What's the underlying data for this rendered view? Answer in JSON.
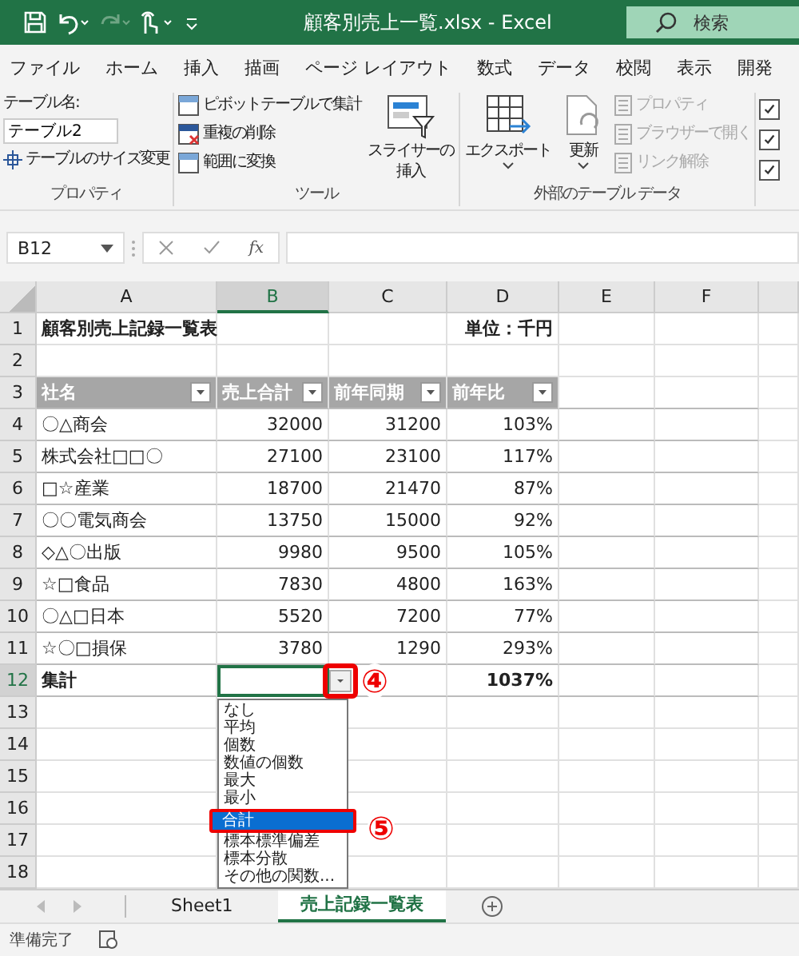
{
  "title_bar": {
    "title": "顧客別売上一覧.xlsx  -  Excel",
    "search": {
      "placeholder": "検索"
    }
  },
  "menu_tabs": [
    "ファイル",
    "ホーム",
    "挿入",
    "描画",
    "ページ レイアウト",
    "数式",
    "データ",
    "校閲",
    "表示",
    "開発"
  ],
  "ribbon": {
    "properties": {
      "label": "プロパティ",
      "name_label": "テーブル名:",
      "name_value": "テーブル2",
      "resize": "テーブルのサイズ変更"
    },
    "tools": {
      "label": "ツール",
      "buttons": [
        "ピボットテーブルで集計",
        "重複の削除",
        "範囲に変換"
      ],
      "slicer": [
        "スライサーの",
        "挿入"
      ]
    },
    "external": {
      "label": "外部のテーブル データ",
      "large": [
        "エクスポート",
        "更新"
      ],
      "small": [
        {
          "label": "プロパティ",
          "disabled": true
        },
        {
          "label": "ブラウザーで開く",
          "disabled": true
        },
        {
          "label": "リンク解除",
          "disabled": true
        }
      ]
    },
    "style_options": [
      {
        "checked": true
      },
      {
        "checked": true
      },
      {
        "checked": true
      }
    ]
  },
  "formula_bar": {
    "name_box": "B12",
    "fx": "fx"
  },
  "sheet": {
    "columns": [
      {
        "label": "A",
        "selected": false
      },
      {
        "label": "B",
        "selected": true
      },
      {
        "label": "C",
        "selected": false
      },
      {
        "label": "D",
        "selected": false
      },
      {
        "label": "E",
        "selected": false
      },
      {
        "label": "F",
        "selected": false
      }
    ],
    "rows": [
      {
        "number": "1",
        "kind": "title",
        "selected": false,
        "cells": {
          "A": "顧客別売上記録一覧表",
          "D": "単位：千円"
        }
      },
      {
        "number": "2",
        "kind": "plain",
        "selected": false,
        "cells": {}
      },
      {
        "number": "3",
        "kind": "header",
        "selected": false,
        "cells": {
          "A": "社名",
          "B": "売上合計",
          "C": "前年同期",
          "D": "前年比"
        }
      },
      {
        "number": "4",
        "kind": "data",
        "selected": false,
        "cells": {
          "A": "〇△商会",
          "B": "32000",
          "C": "31200",
          "D": "103%"
        }
      },
      {
        "number": "5",
        "kind": "data",
        "selected": false,
        "cells": {
          "A": "株式会社□□〇",
          "B": "27100",
          "C": "23100",
          "D": "117%"
        }
      },
      {
        "number": "6",
        "kind": "data",
        "selected": false,
        "cells": {
          "A": "□☆産業",
          "B": "18700",
          "C": "21470",
          "D": "87%"
        }
      },
      {
        "number": "7",
        "kind": "data",
        "selected": false,
        "cells": {
          "A": "〇〇電気商会",
          "B": "13750",
          "C": "15000",
          "D": "92%"
        }
      },
      {
        "number": "8",
        "kind": "data",
        "selected": false,
        "cells": {
          "A": "◇△〇出版",
          "B": "9980",
          "C": "9500",
          "D": "105%"
        }
      },
      {
        "number": "9",
        "kind": "data",
        "selected": false,
        "cells": {
          "A": "☆□食品",
          "B": "7830",
          "C": "4800",
          "D": "163%"
        }
      },
      {
        "number": "10",
        "kind": "data",
        "selected": false,
        "cells": {
          "A": "〇△□日本",
          "B": "5520",
          "C": "7200",
          "D": "77%"
        }
      },
      {
        "number": "11",
        "kind": "data",
        "selected": false,
        "cells": {
          "A": "☆〇□損保",
          "B": "3780",
          "C": "1290",
          "D": "293%"
        }
      },
      {
        "number": "12",
        "kind": "total",
        "selected": true,
        "cells": {
          "A": "集計",
          "D": "1037%"
        }
      },
      {
        "number": "13",
        "kind": "plain",
        "selected": false,
        "cells": {}
      },
      {
        "number": "14",
        "kind": "plain",
        "selected": false,
        "cells": {}
      },
      {
        "number": "15",
        "kind": "plain",
        "selected": false,
        "cells": {}
      },
      {
        "number": "16",
        "kind": "plain",
        "selected": false,
        "cells": {}
      },
      {
        "number": "17",
        "kind": "plain",
        "selected": false,
        "cells": {}
      },
      {
        "number": "18",
        "kind": "plain",
        "selected": false,
        "cells": {}
      }
    ]
  },
  "dropdown": {
    "items": [
      {
        "label": "なし",
        "selected": false
      },
      {
        "label": "平均",
        "selected": false
      },
      {
        "label": "個数",
        "selected": false
      },
      {
        "label": "数値の個数",
        "selected": false
      },
      {
        "label": "最大",
        "selected": false
      },
      {
        "label": "最小",
        "selected": false
      },
      {
        "label": "合計",
        "selected": true
      },
      {
        "label": "標本標準偏差",
        "selected": false
      },
      {
        "label": "標本分散",
        "selected": false
      },
      {
        "label": "その他の関数...",
        "selected": false
      }
    ]
  },
  "annotations": [
    "④",
    "⑤"
  ],
  "sheet_tabs": [
    {
      "label": "Sheet1",
      "selected": false
    },
    {
      "label": "売上記録一覧表",
      "selected": true
    }
  ],
  "status_bar": {
    "text": "準備完了"
  }
}
